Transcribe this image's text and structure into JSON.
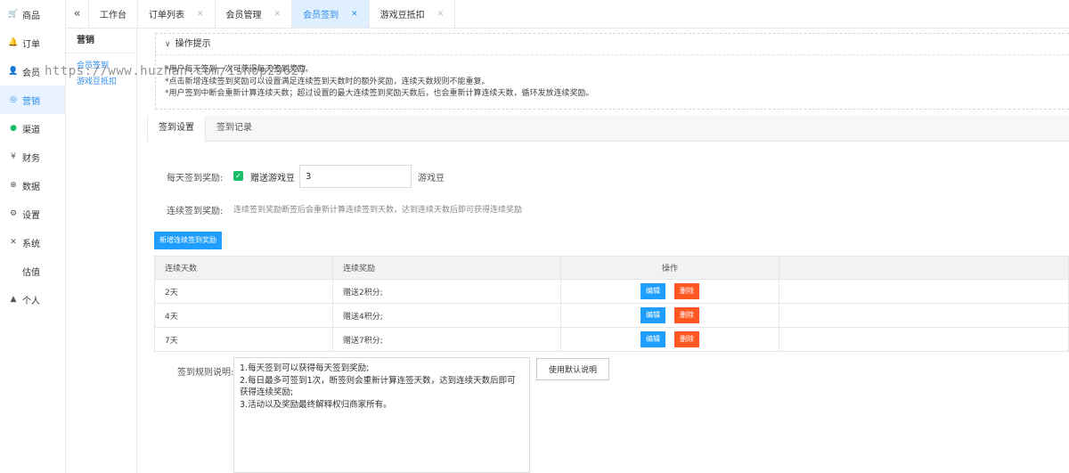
{
  "sidebar": {
    "items": [
      {
        "label": "商品",
        "icon": "cart-icon"
      },
      {
        "label": "订单",
        "icon": "bell-icon"
      },
      {
        "label": "会员",
        "icon": "user-icon"
      },
      {
        "label": "营销",
        "icon": "marketing-icon"
      },
      {
        "label": "渠道",
        "icon": "channel-icon"
      },
      {
        "label": "财务",
        "icon": "finance-icon"
      },
      {
        "label": "数据",
        "icon": "globe-icon"
      },
      {
        "label": "设置",
        "icon": "gear-icon"
      },
      {
        "label": "系统",
        "icon": "system-icon"
      },
      {
        "label": "估值",
        "icon": ""
      },
      {
        "label": "个人",
        "icon": "person-icon"
      }
    ],
    "active": "营销"
  },
  "tabs": [
    {
      "label": "工作台",
      "closable": false
    },
    {
      "label": "订单列表",
      "closable": true
    },
    {
      "label": "会员管理",
      "closable": true
    },
    {
      "label": "会员签到",
      "closable": true,
      "active": true
    },
    {
      "label": "游戏豆抵扣",
      "closable": true
    }
  ],
  "submenu": {
    "title": "营销",
    "items": [
      "会员签到",
      "游戏豆抵扣"
    ]
  },
  "tips": {
    "title": "操作提示",
    "lines": [
      "*用户每天签到一次可获得每天签到奖励。",
      "*点击新增连续签到奖励可以设置满足连续签到天数时的额外奖励，连续天数规则不能重复。",
      "*用户签到中断会重新计算连续天数；超过设置的最大连续签到奖励天数后，也会重新计算连续天数，循环发放连续奖励。"
    ]
  },
  "subtabs": [
    "签到设置",
    "签到记录"
  ],
  "daily": {
    "label": "每天签到奖励:",
    "checkbox_label": "赠送游戏豆",
    "value": "3",
    "unit": "游戏豆"
  },
  "continuous": {
    "label": "连续签到奖励:",
    "hint": "连续签到奖励断签后会重新计算连续签到天数，达到连续天数后即可获得连续奖励"
  },
  "add_button": "新增连续签到奖励",
  "table": {
    "headers": [
      "连续天数",
      "连续奖励",
      "操作"
    ],
    "rows": [
      {
        "days": "2天",
        "reward": "赠送2积分;"
      },
      {
        "days": "4天",
        "reward": "赠送4积分;"
      },
      {
        "days": "7天",
        "reward": "赠送7积分;"
      }
    ],
    "edit_label": "编辑",
    "delete_label": "删除"
  },
  "rules": {
    "label": "签到规则说明:",
    "lines": [
      "1.每天签到可以获得每天签到奖励;",
      "2.每日最多可签到1次，断签则会重新计算连签天数，达到连续天数后即可获得连续奖励;",
      "3.活动以及奖励最终解释权归商家所有。"
    ],
    "default_button": "使用默认说明"
  },
  "watermark": "https://www.huzhan.com/ishop29627",
  "colors": {
    "primary": "#1e9fff",
    "danger": "#ff5722",
    "active_text": "#2d8cf0",
    "checkbox": "#19be6b"
  }
}
